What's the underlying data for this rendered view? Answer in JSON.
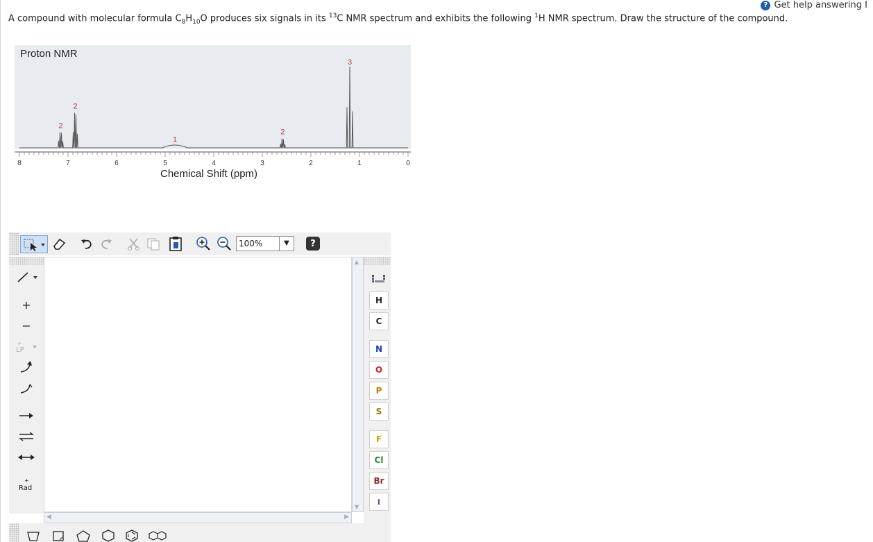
{
  "help": {
    "label": "Get help answering I",
    "icon": "?"
  },
  "question": {
    "part1": "A compound with molecular formula C",
    "sub1": "8",
    "part2": "H",
    "sub2": "10",
    "part3": "O produces six signals in its ",
    "sup1": "13",
    "part4": "C NMR spectrum and exhibits the following ",
    "sup2": "1",
    "part5": "H NMR spectrum. Draw the structure of the compound."
  },
  "chart_data": {
    "type": "line",
    "title": "Proton NMR",
    "xlabel": "Chemical Shift (ppm)",
    "ylabel": "",
    "xlim": [
      8,
      0
    ],
    "x_ticks": [
      "8",
      "7",
      "6",
      "5",
      "4",
      "3",
      "2",
      "1",
      "0"
    ],
    "peaks": [
      {
        "shift": 7.15,
        "integration": "2",
        "relative_height": 0.17
      },
      {
        "shift": 6.85,
        "integration": "2",
        "relative_height": 0.38
      },
      {
        "shift": 4.8,
        "integration": "1",
        "relative_height": 0.02
      },
      {
        "shift": 2.58,
        "integration": "2",
        "relative_height": 0.1
      },
      {
        "shift": 1.2,
        "integration": "3",
        "relative_height": 0.88
      }
    ],
    "grid": false
  },
  "toolbar": {
    "zoom_value": "100%",
    "help_label": "?"
  },
  "left_tools": {
    "lp_label": "LP",
    "rad_label": "Rad",
    "plus_label": "+",
    "minus_label": "−"
  },
  "elements": [
    "H",
    "C",
    "N",
    "O",
    "P",
    "S",
    "F",
    "Cl",
    "Br",
    "I"
  ],
  "element_colors": {
    "H": "#222222",
    "C": "#222222",
    "N": "#1f3fbf",
    "O": "#d42020",
    "P": "#c87a00",
    "S": "#8a7a00",
    "F": "#c8a000",
    "Cl": "#2a8a2a",
    "Br": "#8a2a2a",
    "I": "#7a2a9a"
  }
}
